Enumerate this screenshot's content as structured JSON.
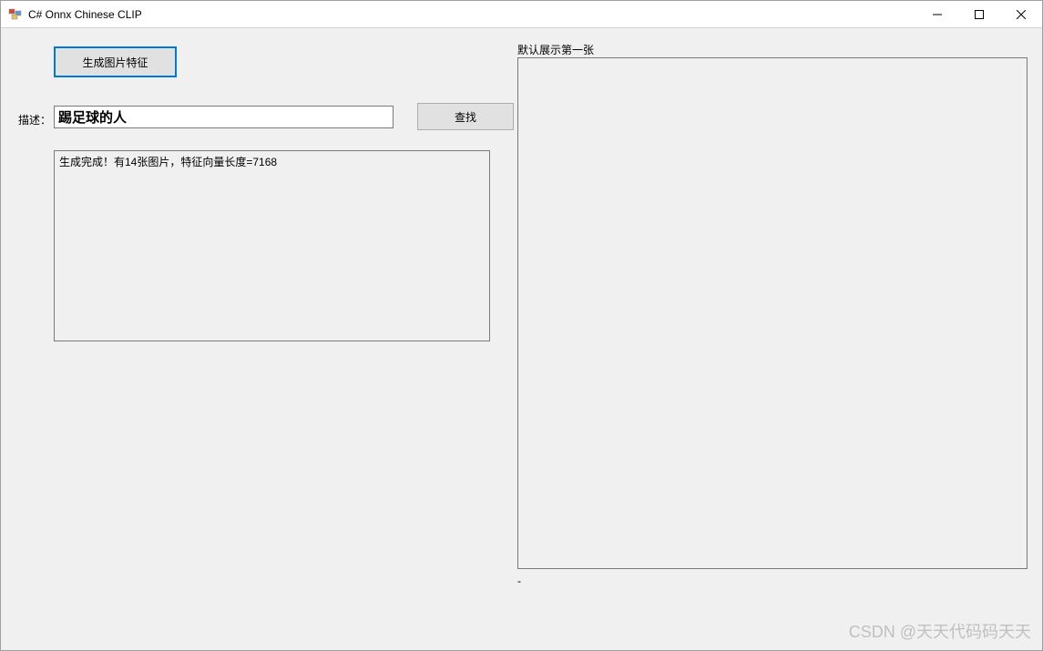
{
  "window": {
    "title": "C# Onnx Chinese CLIP"
  },
  "toolbar": {
    "generate_label": "生成图片特征"
  },
  "form": {
    "desc_label": "描述：",
    "desc_value": "踢足球的人",
    "search_label": "查找"
  },
  "log": {
    "content": "生成完成！有14张图片，特征向量长度=7168"
  },
  "preview": {
    "label": "默认展示第一张",
    "footer": "-"
  },
  "watermark": "CSDN @天天代码码天天"
}
